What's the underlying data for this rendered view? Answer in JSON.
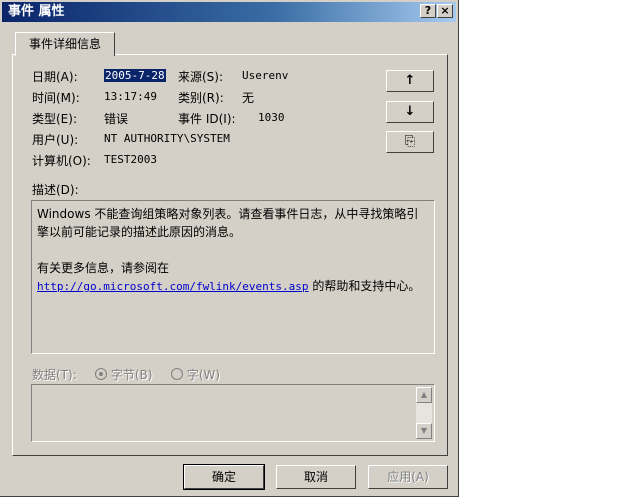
{
  "window": {
    "title": "事件 属性",
    "help_btn": "?",
    "close_btn": "×"
  },
  "tab": {
    "label": "事件详细信息"
  },
  "fields": {
    "date_label": "日期(A):",
    "date_value": "2005-7-28",
    "source_label": "来源(S):",
    "source_value": "Userenv",
    "time_label": "时间(M):",
    "time_value": "13:17:49",
    "category_label": "类别(R):",
    "category_value": "无",
    "type_label": "类型(E):",
    "type_value": "错误",
    "event_id_label": "事件 ID(I):",
    "event_id_value": "1030",
    "user_label": "用户(U):",
    "user_value": "NT AUTHORITY\\SYSTEM",
    "computer_label": "计算机(O):",
    "computer_value": "TEST2003"
  },
  "nav": {
    "up_glyph": "↑",
    "down_glyph": "↓",
    "copy_glyph": "⎘"
  },
  "description": {
    "label": "描述(D):",
    "text": "Windows 不能查询组策略对象列表。请查看事件日志，从中寻找策略引擎以前可能记录的描述此原因的消息。",
    "more_info": "有关更多信息，请参阅在",
    "link": "http://go.microsoft.com/fwlink/events.asp",
    "suffix": "的帮助和支持中心。"
  },
  "data_section": {
    "label": "数据(T):",
    "bytes_label": "字节(B)",
    "words_label": "字(W)"
  },
  "buttons": {
    "ok": "确定",
    "cancel": "取消",
    "apply": "应用(A)"
  },
  "colors": {
    "title_bar": "#0a246a",
    "face": "#d4d0c8",
    "link": "#0000cc"
  }
}
